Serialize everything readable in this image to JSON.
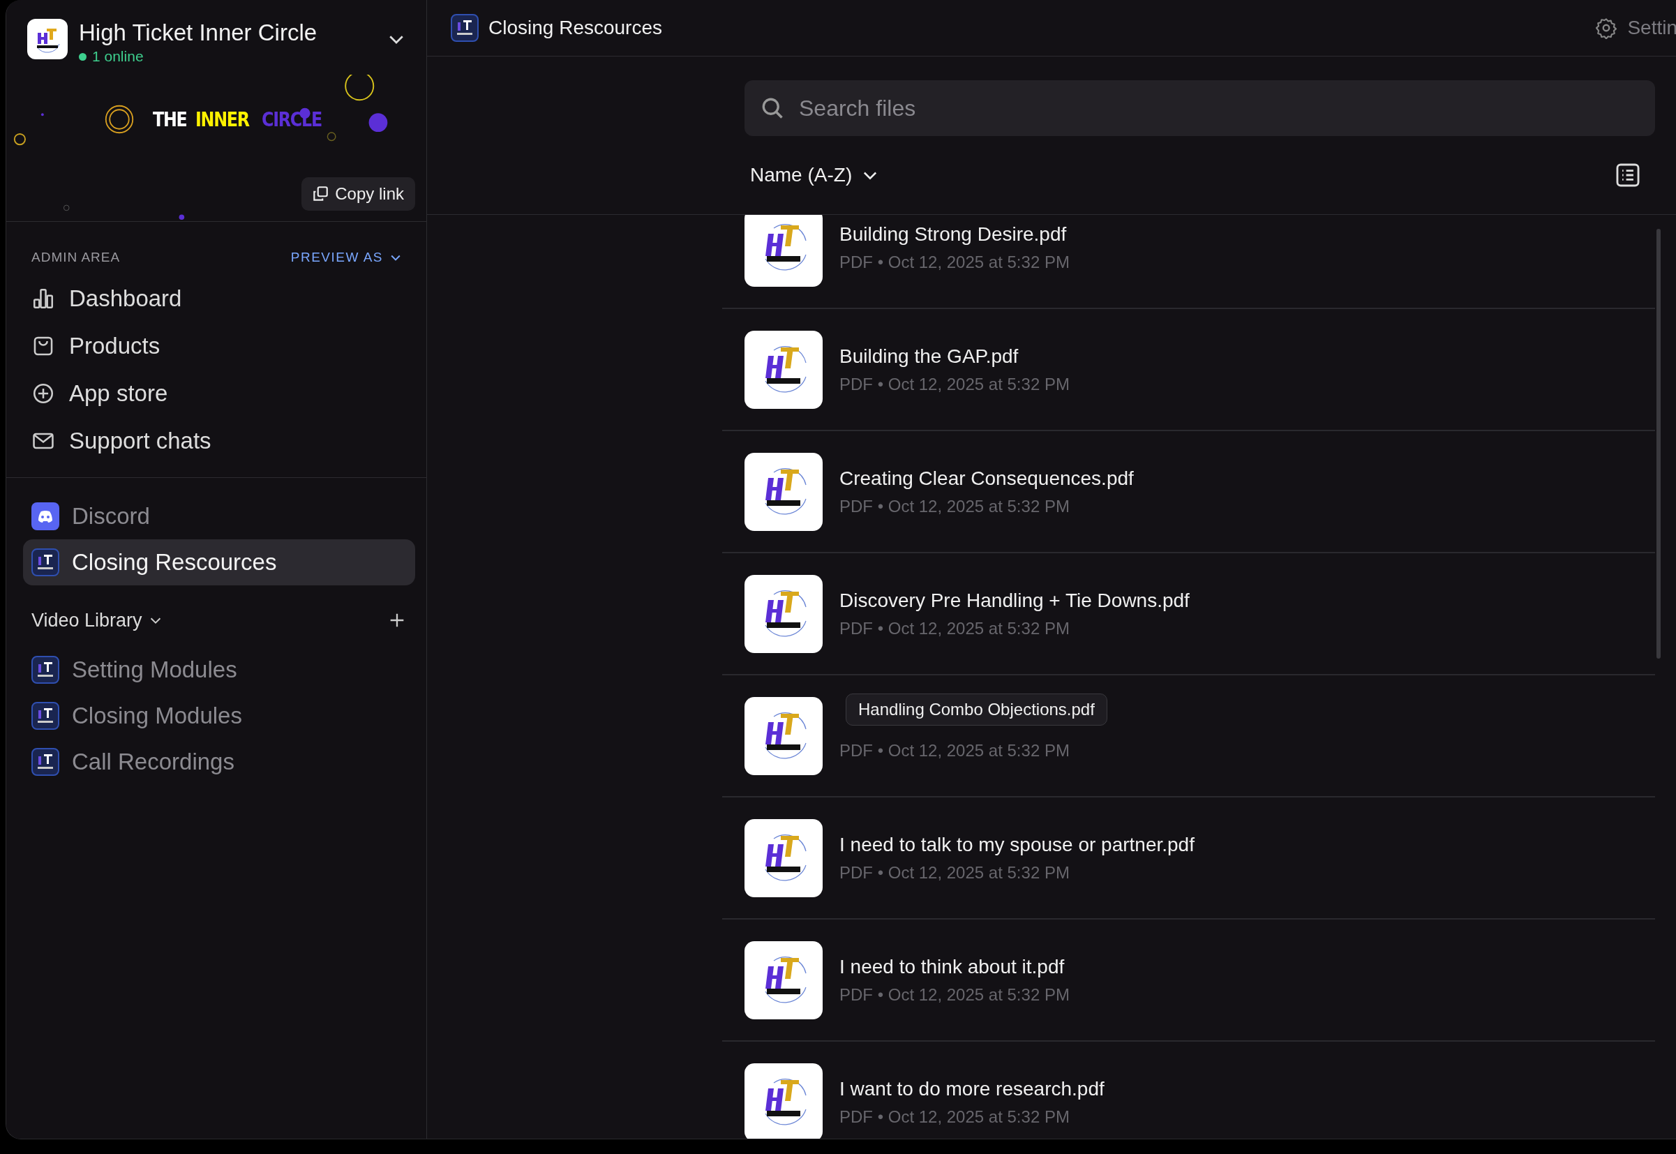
{
  "workspace": {
    "name": "High Ticket Inner Circle",
    "online": "1 online"
  },
  "banner": {
    "words": [
      {
        "text": "THE",
        "color": "#ffffff"
      },
      {
        "text": "INNER",
        "color": "#fff200"
      },
      {
        "text": "CIRCLE",
        "color": "#5b2fd6"
      }
    ],
    "copy_link": "Copy link"
  },
  "admin": {
    "heading": "ADMIN AREA",
    "preview": "PREVIEW AS",
    "items": [
      {
        "label": "Dashboard"
      },
      {
        "label": "Products"
      },
      {
        "label": "App store"
      },
      {
        "label": "Support chats"
      }
    ]
  },
  "apps": [
    {
      "label": "Discord",
      "kind": "discord",
      "selected": false
    },
    {
      "label": "Closing Rescources",
      "kind": "logo",
      "selected": true
    }
  ],
  "section": {
    "title": "Video Library",
    "items": [
      {
        "label": "Setting Modules",
        "selected": false
      },
      {
        "label": "Closing Modules",
        "selected": false
      },
      {
        "label": "Call Recordings",
        "selected": false
      }
    ]
  },
  "header": {
    "title": "Closing Rescources",
    "settings": "Settin"
  },
  "search": {
    "placeholder": "Search files"
  },
  "sort": {
    "label": "Name (A-Z)"
  },
  "files": [
    {
      "name": "Building Strong Desire.pdf",
      "meta": "PDF • Oct 12, 2025 at 5:32 PM"
    },
    {
      "name": "Building the GAP.pdf",
      "meta": "PDF • Oct 12, 2025 at 5:32 PM"
    },
    {
      "name": "Creating Clear Consequences.pdf",
      "meta": "PDF • Oct 12, 2025 at 5:32 PM"
    },
    {
      "name": "Discovery Pre Handling + Tie Downs.pdf",
      "meta": "PDF • Oct 12, 2025 at 5:32 PM"
    },
    {
      "meta": "PDF • Oct 12, 2025 at 5:32 PM",
      "tooltip": "Handling Combo Objections.pdf"
    },
    {
      "name": "I need to talk to my spouse or partner.pdf",
      "meta": "PDF • Oct 12, 2025 at 5:32 PM"
    },
    {
      "name": "I need to think about it.pdf",
      "meta": "PDF • Oct 12, 2025 at 5:32 PM"
    },
    {
      "name": "I want to do more research.pdf",
      "meta": "PDF • Oct 12, 2025 at 5:32 PM"
    }
  ]
}
